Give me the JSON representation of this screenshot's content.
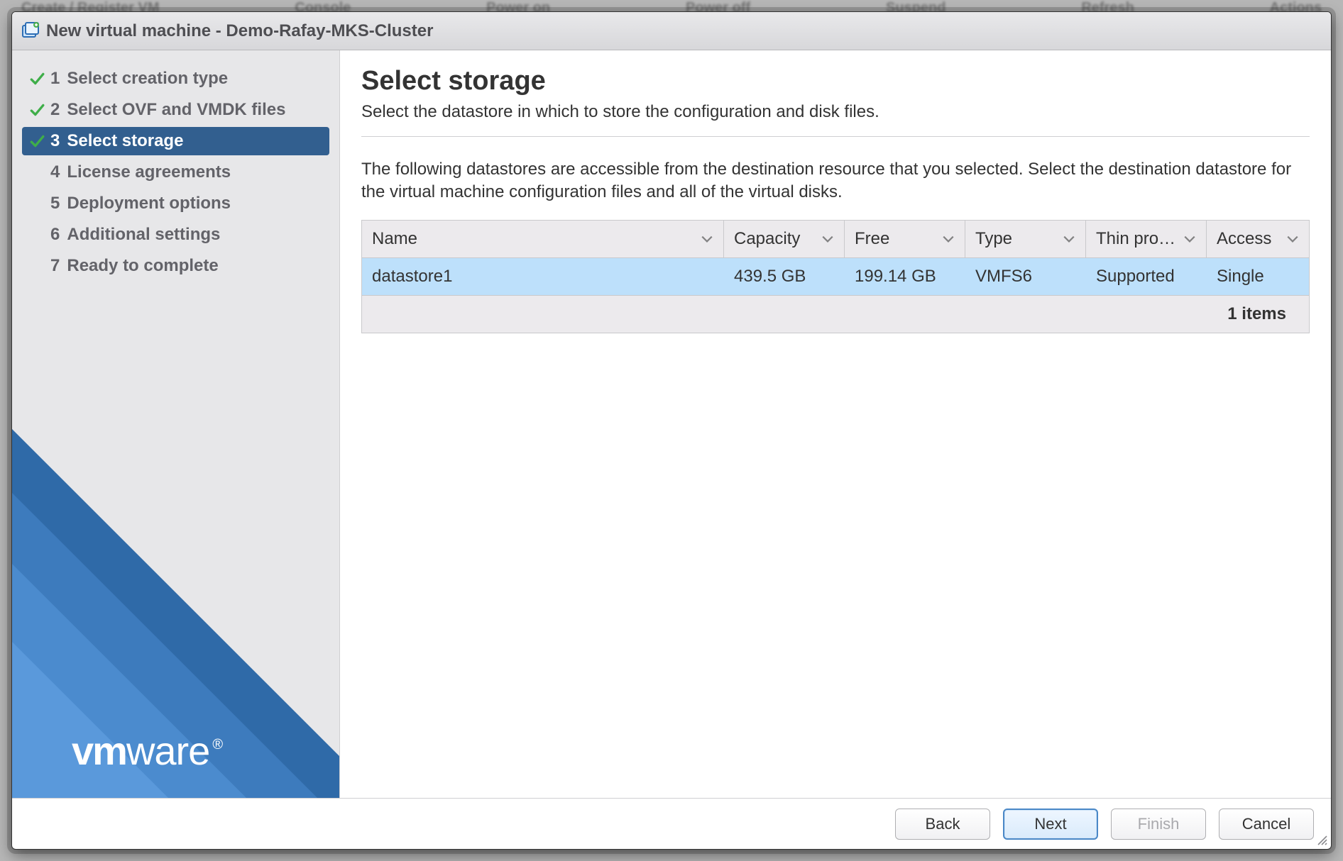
{
  "background_toolbar": {
    "left": "Create / Register VM",
    "items": [
      "Console",
      "Power on",
      "Power off",
      "Suspend",
      "Refresh",
      "Actions"
    ]
  },
  "dialog": {
    "title": "New virtual machine - Demo-Rafay-MKS-Cluster"
  },
  "sidebar": {
    "logo": "vmware",
    "steps": [
      {
        "num": "1",
        "label": "Select creation type",
        "done": true,
        "active": false
      },
      {
        "num": "2",
        "label": "Select OVF and VMDK files",
        "done": true,
        "active": false
      },
      {
        "num": "3",
        "label": "Select storage",
        "done": true,
        "active": true
      },
      {
        "num": "4",
        "label": "License agreements",
        "done": false,
        "active": false
      },
      {
        "num": "5",
        "label": "Deployment options",
        "done": false,
        "active": false
      },
      {
        "num": "6",
        "label": "Additional settings",
        "done": false,
        "active": false
      },
      {
        "num": "7",
        "label": "Ready to complete",
        "done": false,
        "active": false
      }
    ]
  },
  "page": {
    "title": "Select storage",
    "subtitle": "Select the datastore in which to store the configuration and disk files.",
    "description": "The following datastores are accessible from the destination resource that you selected. Select the destination datastore for the virtual machine configuration files and all of the virtual disks."
  },
  "table": {
    "columns": {
      "name": "Name",
      "capacity": "Capacity",
      "free": "Free",
      "type": "Type",
      "thin": "Thin pro…",
      "access": "Access"
    },
    "rows": [
      {
        "name": "datastore1",
        "capacity": "439.5 GB",
        "free": "199.14 GB",
        "type": "VMFS6",
        "thin": "Supported",
        "access": "Single"
      }
    ],
    "footer": "1 items"
  },
  "buttons": {
    "back": "Back",
    "next": "Next",
    "finish": "Finish",
    "cancel": "Cancel"
  }
}
